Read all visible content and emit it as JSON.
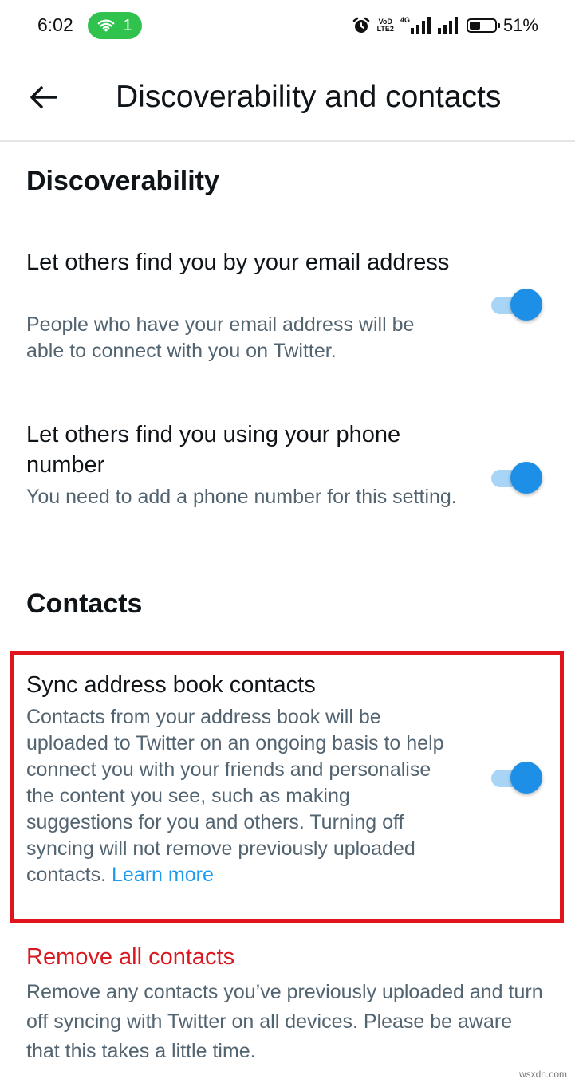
{
  "status_bar": {
    "time": "6:02",
    "wifi_count": "1",
    "network_vo": "VoD",
    "network_lte": "LTE2",
    "network_4g": "4G",
    "battery": "51%",
    "battery_level": 0.51
  },
  "app_bar": {
    "title": "Discoverability and contacts"
  },
  "discoverability": {
    "header": "Discoverability",
    "settings": [
      {
        "title": "Let others find you by your email address",
        "description": "People who have your email address will be able to connect with you on Twitter.",
        "enabled": true
      },
      {
        "title": "Let others find you using your phone number",
        "description": "You need to add a phone number for this setting.",
        "enabled": true
      }
    ]
  },
  "contacts": {
    "header": "Contacts",
    "sync": {
      "title": "Sync address book contacts",
      "description": "Contacts from your address book will be uploaded to Twitter on an ongoing basis to help connect you with your friends and personalise the content you see, such as making suggestions for you and others. Turning off syncing will not remove previously uploaded contacts.",
      "learn_more": "Learn more",
      "enabled": true
    },
    "remove": {
      "title": "Remove all contacts",
      "description": "Remove any contacts you’ve previously uploaded and turn off syncing with Twitter on all devices. Please be aware that this takes a little time."
    }
  },
  "watermark": "wsxdn.com",
  "colors": {
    "accent": "#1d9bf0",
    "toggle_thumb": "#1d8fe6",
    "danger": "#d9181f",
    "highlight": "#e0141c"
  }
}
